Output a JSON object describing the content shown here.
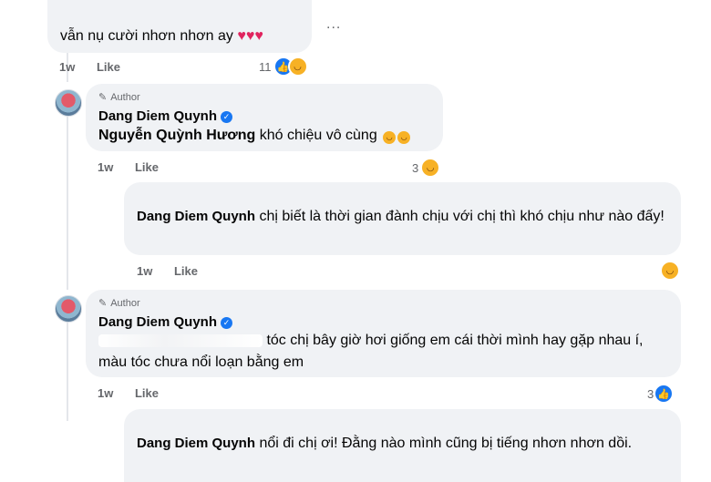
{
  "comment1": {
    "text": "vẫn nụ cười nhơn nhơn ay",
    "time": "1w",
    "like": "Like",
    "reaction_count": "11",
    "more": "..."
  },
  "reply1": {
    "author_tag": "Author",
    "name": "Dang Diem Quynh",
    "mention": "Nguyễn Quỳnh Hương",
    "text": "khó chiệu vô cùng",
    "emoji": "🤣🤣",
    "time": "1w",
    "like": "Like",
    "reaction_count": "3"
  },
  "reply2": {
    "name": "Dang Diem Quynh",
    "text": "chị biết là thời gian đành chịu với chị thì khó chịu như nào đấy!",
    "time": "1w",
    "like": "Like"
  },
  "reply3": {
    "author_tag": "Author",
    "name": "Dang Diem Quynh",
    "text": "tóc chị bây giờ hơi giống em cái thời mình hay gặp nhau í, màu tóc chưa nổi loạn bằng em",
    "time": "1w",
    "like": "Like",
    "reaction_count": "3"
  },
  "reply4": {
    "name": "Dang Diem Quynh",
    "text": "nổi đi chị ơi! Đằng nào mình cũng bị tiếng nhơn nhơn dồi."
  },
  "icons": {
    "heart": "heart-icon",
    "like": "like-reaction-icon",
    "haha": "haha-reaction-icon",
    "pencil": "pencil-icon",
    "verified": "verified-badge-icon"
  },
  "colors": {
    "bubble": "#f0f2f5",
    "meta_text": "#65676b",
    "like_blue": "#1877f2",
    "haha_yellow": "#f7b125",
    "heart_red": "#e0245e"
  }
}
